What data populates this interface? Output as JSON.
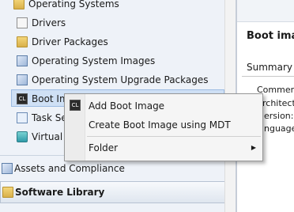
{
  "nav": {
    "items": [
      {
        "label": "Operating Systems",
        "icon": "folder-icon"
      },
      {
        "label": "Drivers",
        "icon": "driver-icon"
      },
      {
        "label": "Driver Packages",
        "icon": "package-icon"
      },
      {
        "label": "Operating System Images",
        "icon": "os-image-icon"
      },
      {
        "label": "Operating System Upgrade Packages",
        "icon": "upgrade-package-icon"
      },
      {
        "label": "Boot Ima",
        "icon": "boot-image-icon"
      },
      {
        "label": "Task Se",
        "icon": "task-sequence-icon"
      },
      {
        "label": "Virtual",
        "icon": "virtual-hard-disk-icon"
      }
    ],
    "wunderbar": [
      {
        "label": "Assets and Compliance",
        "icon": "assets-icon"
      },
      {
        "label": "Software Library",
        "icon": "software-library-icon"
      }
    ]
  },
  "details": {
    "title": "Boot imag",
    "summary": "Summary",
    "properties": [
      "Commen",
      "rchitect",
      "ersion:",
      "nguage"
    ]
  },
  "context_menu": {
    "items": [
      {
        "label": "Add Boot Image",
        "icon": "cl-icon"
      },
      {
        "label": "Create Boot Image using MDT"
      },
      {
        "label": "Folder",
        "submenu": "▶"
      }
    ]
  },
  "colors": {
    "selection": "#cfe0f5",
    "nav_background": "#eef2f8",
    "menu_background": "#f5f5f5"
  }
}
